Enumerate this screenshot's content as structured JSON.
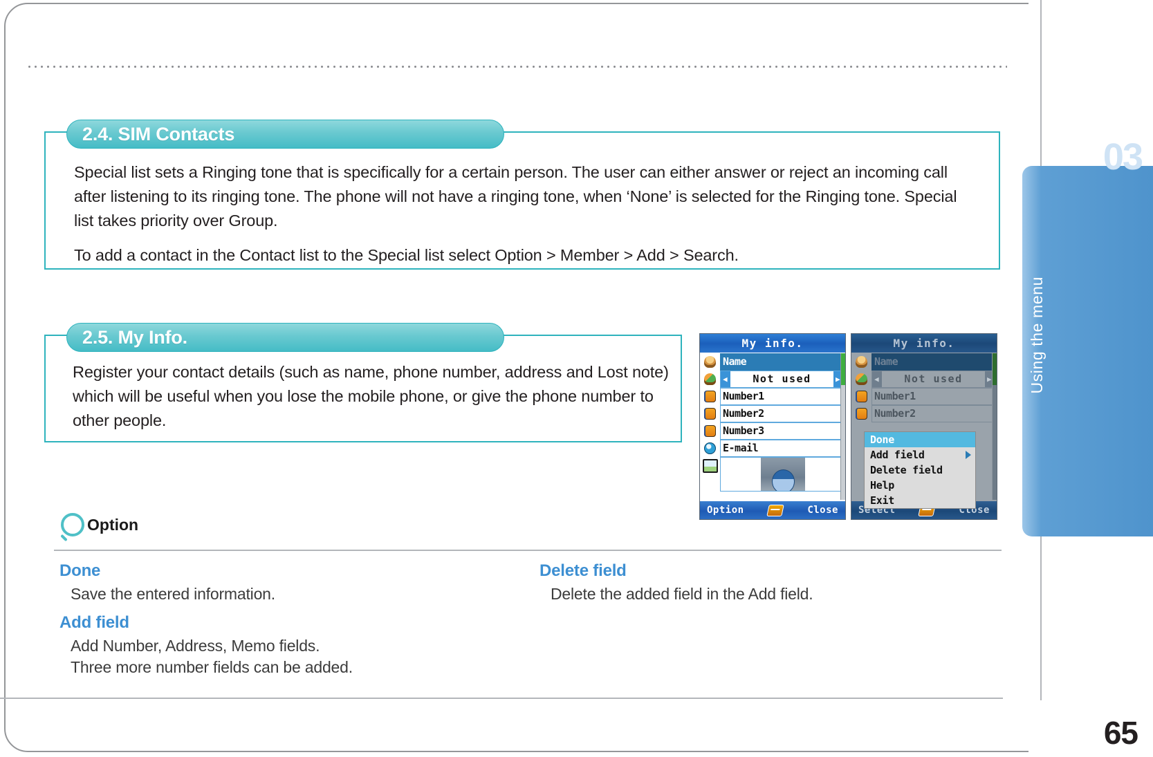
{
  "page": {
    "number": "65",
    "chapter_number": "03",
    "chapter_label": "Using the menu"
  },
  "sections": [
    {
      "tab_label": "2.4. SIM Contacts",
      "paragraphs": [
        "Special list sets a Ringing tone that is specifically for a certain person. The user can either answer or reject an incoming call after listening to its ringing tone. The phone will not have a ringing tone, when ‘None’ is selected for the Ringing tone. Special list takes priority over Group.",
        "To add a contact in the Contact list to the Special list select Option > Member > Add > Search."
      ]
    },
    {
      "tab_label": "2.5. My Info.",
      "paragraphs": [
        "Register your contact details (such as name, phone number, address and Lost note) which will be useful when you lose the mobile phone, or give the phone number to other people."
      ]
    }
  ],
  "phone_left": {
    "title": "My info.",
    "rows": [
      {
        "label": "Name",
        "icon": "person-icon",
        "state": "selected"
      },
      {
        "label": "Not used",
        "icon": "group-icon",
        "state": "spinner"
      },
      {
        "label": "Number1",
        "icon": "phone-icon",
        "state": "normal"
      },
      {
        "label": "Number2",
        "icon": "phone-icon",
        "state": "normal"
      },
      {
        "label": "Number3",
        "icon": "phone-icon",
        "state": "normal"
      },
      {
        "label": "E-mail",
        "icon": "mail-icon",
        "state": "normal"
      },
      {
        "label": "",
        "icon": "photo-icon",
        "state": "photo"
      }
    ],
    "softkey_left": "Option",
    "softkey_right": "Close"
  },
  "phone_right": {
    "title": "My info.",
    "rows": [
      {
        "label": "Name",
        "icon": "person-icon",
        "state": "selected"
      },
      {
        "label": "Not used",
        "icon": "group-icon",
        "state": "spinner"
      },
      {
        "label": "Number1",
        "icon": "phone-icon",
        "state": "normal"
      },
      {
        "label": "Number2",
        "icon": "phone-icon",
        "state": "normal"
      }
    ],
    "menu": [
      {
        "label": "Done",
        "highlighted": true,
        "submenu": false
      },
      {
        "label": "Add field",
        "highlighted": false,
        "submenu": true
      },
      {
        "label": "Delete field",
        "highlighted": false,
        "submenu": false
      },
      {
        "label": "Help",
        "highlighted": false,
        "submenu": false
      },
      {
        "label": "Exit",
        "highlighted": false,
        "submenu": false
      }
    ],
    "softkey_left": "Select",
    "softkey_right": "Close"
  },
  "option": {
    "heading": "Option",
    "entries": [
      {
        "title": "Done",
        "desc": "Save the entered information."
      },
      {
        "title": "Add field",
        "desc": "Add Number, Address, Memo fields.\nThree more number fields can be added."
      },
      {
        "title": "Delete field",
        "desc": "Delete the added field in the Add field."
      }
    ]
  },
  "colors": {
    "teal": "#2eb3bd",
    "option_blue": "#3d8fd2",
    "tab_blue": "#4e93cc"
  }
}
